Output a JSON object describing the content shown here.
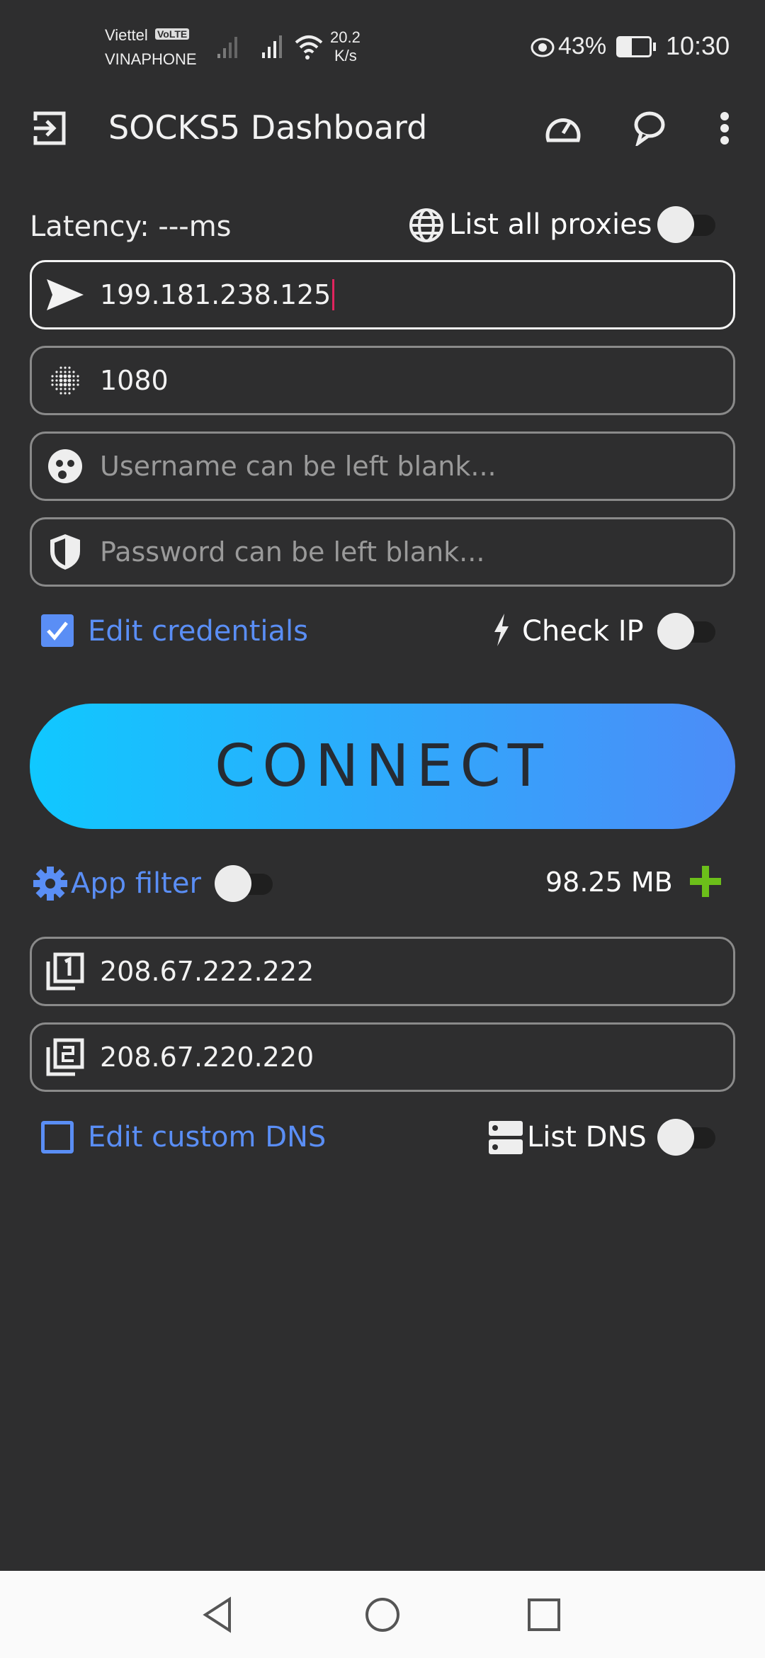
{
  "status_bar": {
    "carrier1": "Viettel",
    "volte": "VoLTE",
    "carrier2": "VINAPHONE",
    "speed_value": "20.2",
    "speed_unit": "K/s",
    "battery": "43%",
    "battery_level": 0.43,
    "time": "10:30"
  },
  "appbar": {
    "title": "SOCKS5 Dashboard",
    "icons": [
      "exit-icon",
      "speedometer-icon",
      "chat-icon",
      "more-vert-icon"
    ]
  },
  "top_row": {
    "latency": "Latency: ---ms",
    "list_proxies_label": "List all proxies",
    "list_proxies_on": false
  },
  "fields": {
    "server": {
      "value": "199.181.238.125",
      "icon": "send-icon"
    },
    "port": {
      "value": "1080",
      "icon": "dots-grid-icon"
    },
    "username": {
      "value": "",
      "placeholder": "Username can be left blank...",
      "icon": "user-face-icon"
    },
    "password": {
      "value": "",
      "placeholder": "Password can be left blank...",
      "icon": "shield-icon"
    }
  },
  "credentials_row": {
    "edit_label": "Edit credentials",
    "edit_checked": true,
    "check_ip_label": "Check IP",
    "check_ip_on": false
  },
  "connect_label": "CONNECT",
  "filter_row": {
    "app_filter_label": "App filter",
    "app_filter_on": false,
    "data_usage": "98.25 MB"
  },
  "dns": {
    "primary": "208.67.222.222",
    "secondary": "208.67.220.220",
    "edit_label": "Edit custom DNS",
    "edit_checked": false,
    "list_label": "List DNS",
    "list_on": false
  },
  "colors": {
    "accent_blue": "#5a8ef5",
    "gradient_start": "#10c8ff",
    "gradient_end": "#4c8cf8",
    "plus_green": "#6cbf1a",
    "caret": "#e0245e"
  }
}
